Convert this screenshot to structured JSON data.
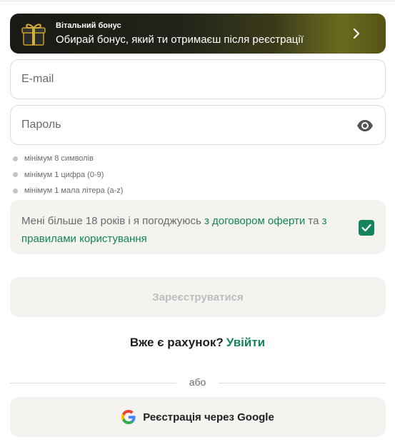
{
  "bonus": {
    "title": "Вітальний бонус",
    "subtitle": "Обирай бонус, який ти отримаєш після реєстрації",
    "gift_icon": "gift-icon",
    "chevron_icon": "chevron-right-icon"
  },
  "email": {
    "placeholder": "E-mail",
    "value": ""
  },
  "password": {
    "placeholder": "Пароль",
    "value": "",
    "eye_icon": "eye-icon"
  },
  "password_rules": [
    "мінімум 8 символів",
    "мінімум 1 цифра (0-9)",
    "мінімум 1 мала літера (a-z)"
  ],
  "agreement": {
    "text_before": "Мені більше 18 років і я погоджуюсь ",
    "offer_link": "з договором оферти",
    "text_middle": " та ",
    "rules_link": "з правилами користування",
    "checked": true
  },
  "register_button": "Зареєструватися",
  "login_prompt": {
    "question": "Вже є рахунок?",
    "link": "Увійти"
  },
  "divider_text": "або",
  "google_button": {
    "label": "Реєстрація через Google",
    "icon": "google-icon"
  },
  "colors": {
    "accent": "#13845b",
    "panel": "#f4f3ef",
    "muted": "#6a6a6a"
  }
}
